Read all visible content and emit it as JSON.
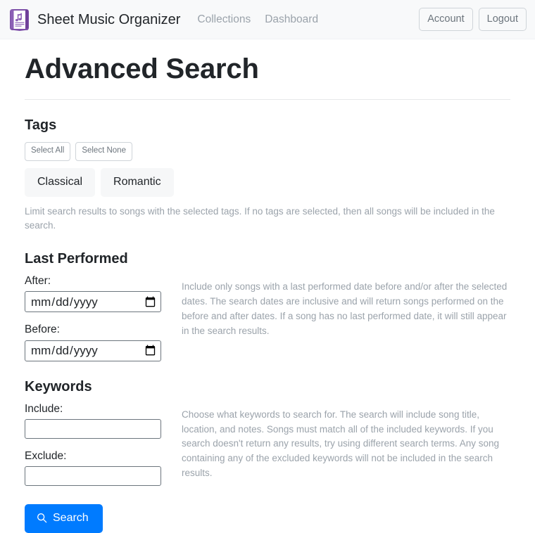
{
  "navbar": {
    "logo_icon": "sheet-music-book-icon",
    "brand": "Sheet Music Organizer",
    "links": [
      {
        "label": "Collections"
      },
      {
        "label": "Dashboard"
      }
    ],
    "account_label": "Account",
    "logout_label": "Logout"
  },
  "page": {
    "title": "Advanced Search"
  },
  "tags": {
    "heading": "Tags",
    "select_all_label": "Select All",
    "select_none_label": "Select None",
    "items": [
      {
        "label": "Classical"
      },
      {
        "label": "Romantic"
      }
    ],
    "help": "Limit search results to songs with the selected tags. If no tags are selected, then all songs will be included in the search."
  },
  "last_performed": {
    "heading": "Last Performed",
    "after_label": "After:",
    "after_value": "",
    "after_placeholder": "mm/dd/yyyy",
    "before_label": "Before:",
    "before_value": "",
    "before_placeholder": "mm/dd/yyyy",
    "help": "Include only songs with a last performed date before and/or after the selected dates. The search dates are inclusive and will return songs performed on the before and after dates. If a song has no last performed date, it will still appear in the search results."
  },
  "keywords": {
    "heading": "Keywords",
    "include_label": "Include:",
    "include_value": "",
    "include_placeholder": "",
    "exclude_label": "Exclude:",
    "exclude_value": "",
    "exclude_placeholder": "",
    "help": "Choose what keywords to search for. The search will include song title, location, and notes. Songs must match all of the included keywords. If you search doesn't return any results, try using different search terms. Any song containing any of the excluded keywords will not be included in the search results."
  },
  "submit": {
    "icon": "search-icon",
    "label": "Search"
  },
  "colors": {
    "accent_blue": "#007bff",
    "brand_purple": "#7d4fa8",
    "navbar_bg": "#f8f9fa",
    "muted_text": "#9ba3ab",
    "chip_bg": "#f6f7f8"
  }
}
